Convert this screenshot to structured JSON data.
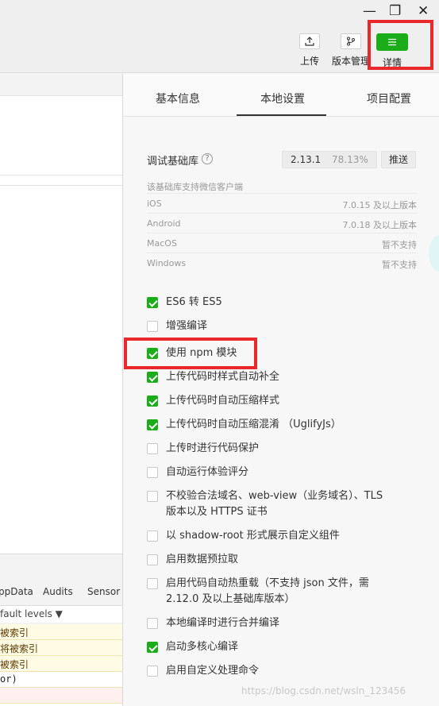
{
  "window_controls": {
    "minimize": "—",
    "maximize": "❐",
    "close": "✕"
  },
  "toolbar": {
    "upload_label": "上传",
    "version_label": "版本管理",
    "details_label": "详情"
  },
  "tabs": {
    "basic": "基本信息",
    "local": "本地设置",
    "project": "项目配置"
  },
  "library": {
    "label": "调试基础库",
    "help": "?",
    "version": "2.13.1",
    "percent": "78.13%",
    "push_button": "推送"
  },
  "support": {
    "note": "该基础库支持微信客户端",
    "rows": [
      {
        "os": "iOS",
        "req": "7.0.15 及以上版本"
      },
      {
        "os": "Android",
        "req": "7.0.18 及以上版本"
      },
      {
        "os": "MacOS",
        "req": "暂不支持"
      },
      {
        "os": "Windows",
        "req": "暂不支持"
      }
    ]
  },
  "options": [
    {
      "label": "ES6 转 ES5",
      "checked": true
    },
    {
      "label": "增强编译",
      "checked": false
    },
    {
      "label": "使用 npm 模块",
      "checked": true
    },
    {
      "label": "上传代码时样式自动补全",
      "checked": true
    },
    {
      "label": "上传代码时自动压缩样式",
      "checked": true
    },
    {
      "label": "上传代码时自动压缩混淆 （UglifyJs）",
      "checked": true
    },
    {
      "label": "上传时进行代码保护",
      "checked": false
    },
    {
      "label": "自动运行体验评分",
      "checked": false
    },
    {
      "label": "不校验合法域名、web-view（业务域名）、TLS",
      "label2": "版本以及 HTTPS 证书",
      "checked": false
    },
    {
      "label": "以 shadow-root 形式展示自定义组件",
      "checked": false
    },
    {
      "label": "启用数据预拉取",
      "checked": false
    },
    {
      "label": "启用代码自动热重载（不支持 json 文件，需",
      "label2": "2.12.0 及以上基础库版本）",
      "checked": false
    },
    {
      "label": "本地编译时进行合并编译",
      "checked": false
    },
    {
      "label": "启动多核心编译",
      "checked": true
    },
    {
      "label": "启用自定义处理命令",
      "checked": false
    }
  ],
  "console": {
    "tabs": [
      "ppData",
      "Audits",
      "Sensor"
    ],
    "levels": "fault levels ▼",
    "logs": [
      "被索引",
      "将被索引",
      "被索引",
      "or)"
    ]
  },
  "watermark": "https://blog.csdn.net/wsln_123456",
  "colors": {
    "accent": "#1aad19",
    "highlight": "#e8282b"
  }
}
